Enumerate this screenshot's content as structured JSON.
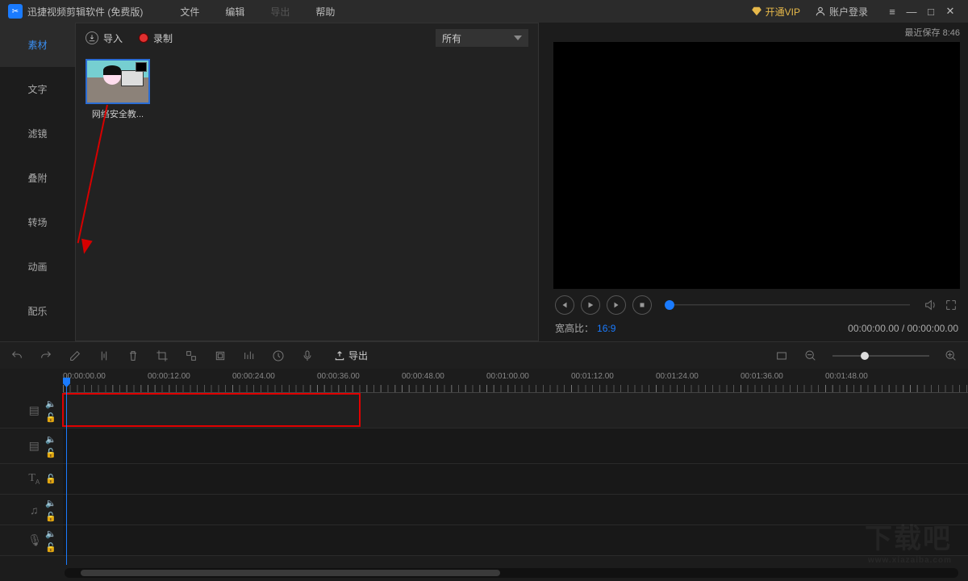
{
  "title": "迅捷视频剪辑软件 (免费版)",
  "menu": {
    "file": "文件",
    "edit": "编辑",
    "export": "导出",
    "help": "帮助"
  },
  "header": {
    "vip": "开通VIP",
    "login": "账户登录"
  },
  "sidetabs": [
    "素材",
    "文字",
    "滤镜",
    "叠附",
    "转场",
    "动画",
    "配乐"
  ],
  "mediabar": {
    "import": "导入",
    "record": "录制",
    "filter": "所有"
  },
  "mediaItems": [
    {
      "name": "网络安全教..."
    }
  ],
  "preview": {
    "lastSave": "最近保存 8:46",
    "aspectLabel": "宽高比：",
    "aspectValue": "16:9",
    "timeCurrent": "00:00:00.00",
    "timeTotal": "00:00:00.00"
  },
  "toolbar": {
    "export": "导出"
  },
  "timeline": {
    "labels": [
      "00:00:00.00",
      "00:00:12.00",
      "00:00:24.00",
      "00:00:36.00",
      "00:00:48.00",
      "00:01:00.00",
      "00:01:12.00",
      "00:01:24.00",
      "00:01:36.00",
      "00:01:48.00"
    ]
  },
  "watermark": {
    "main": "下载吧",
    "sub": "www.xiazaiba.com"
  }
}
